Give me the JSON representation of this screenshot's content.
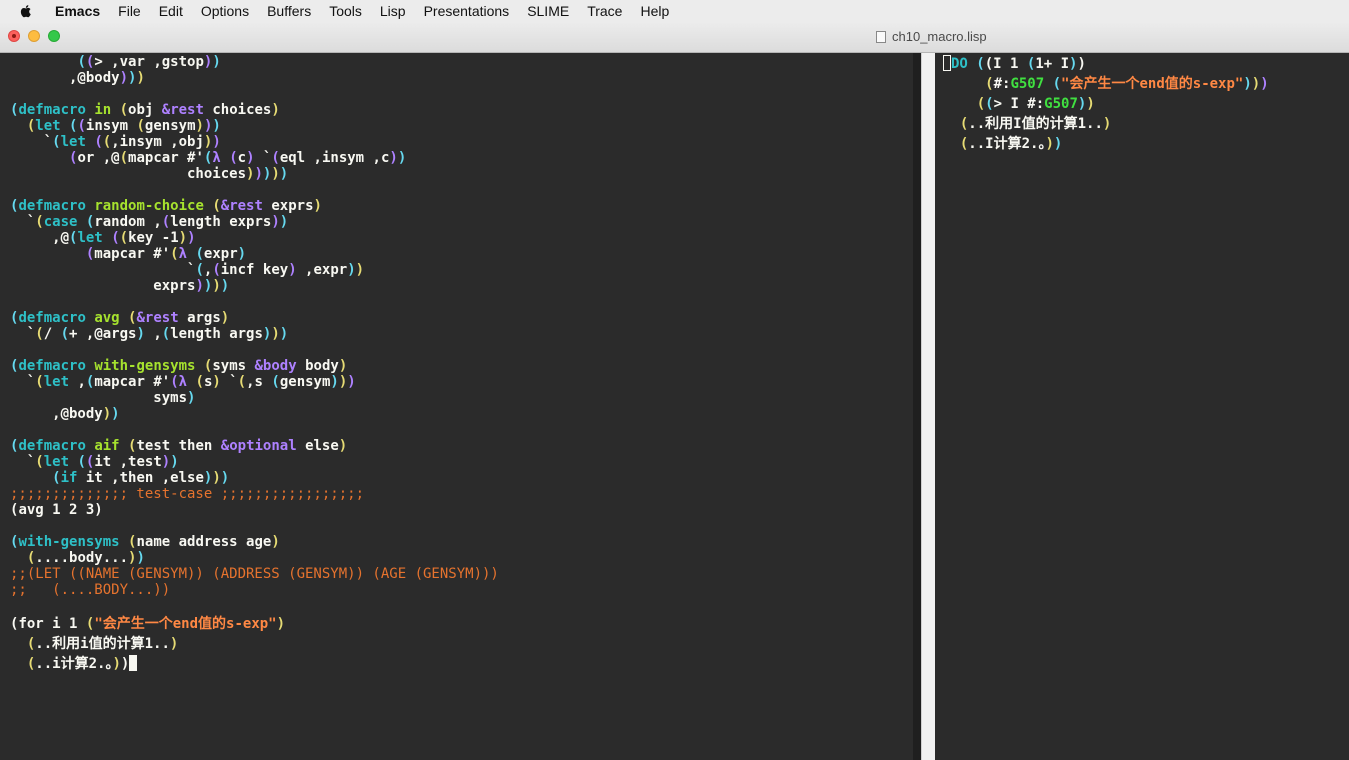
{
  "menubar": {
    "app_name": "Emacs",
    "items": [
      "File",
      "Edit",
      "Options",
      "Buffers",
      "Tools",
      "Lisp",
      "Presentations",
      "SLIME",
      "Trace",
      "Help"
    ]
  },
  "window": {
    "title": "ch10_macro.lisp"
  },
  "left_buffer": {
    "lines": [
      "        ((> ,var ,gstop))",
      "       ,@body)))",
      "",
      "(defmacro in (obj &rest choices)",
      "  (let ((insym (gensym)))",
      "    `(let ((,insym ,obj))",
      "       (or ,@(mapcar #'(λ (c) `(eql ,insym ,c))",
      "                     choices)))))",
      "",
      "(defmacro random-choice (&rest exprs)",
      "  `(case (random ,(length exprs))",
      "     ,@(let ((key -1))",
      "         (mapcar #'(λ (expr)",
      "                     `(,(incf key) ,expr))",
      "                 exprs))))",
      "",
      "(defmacro avg (&rest args)",
      "  `(/ (+ ,@args) ,(length args)))",
      "",
      "(defmacro with-gensyms (syms &body body)",
      "  `(let ,(mapcar #'(λ (s) `(,s (gensym)))",
      "                 syms)",
      "     ,@body))",
      "",
      "(defmacro aif (test then &optional else)",
      "  `(let ((it ,test))",
      "     (if it ,then ,else)))",
      ";;;;;;;;;;;;;; test-case ;;;;;;;;;;;;;;;;;",
      "(avg 1 2 3)",
      "",
      "(with-gensyms (name address age)",
      "  (....body...))",
      ";;(LET ((NAME (GENSYM)) (ADDRESS (GENSYM)) (AGE (GENSYM)))",
      ";;   (....BODY...))",
      "",
      "(for i 1 (\"会产生一个end值的s-exp\")",
      "  (..利用i值的计算1..)",
      "  (..i计算2.。))"
    ]
  },
  "right_buffer": {
    "lines": [
      "(DO ((I 1 (1+ I))",
      "     (#:G507 (\"会产生一个end值的s-exp\")))",
      "    ((> I #:G507))",
      "  (..利用I值的计算1..)",
      "  (..I计算2.。))"
    ]
  },
  "colors": {
    "background": "#2b2b2b",
    "keyword": "#2ec0c7",
    "function_name": "#a6e22e",
    "lambda_keyword": "#ae81ff",
    "comment": "#e6732e",
    "string": "#ff8844",
    "gensym": "#40e040"
  }
}
